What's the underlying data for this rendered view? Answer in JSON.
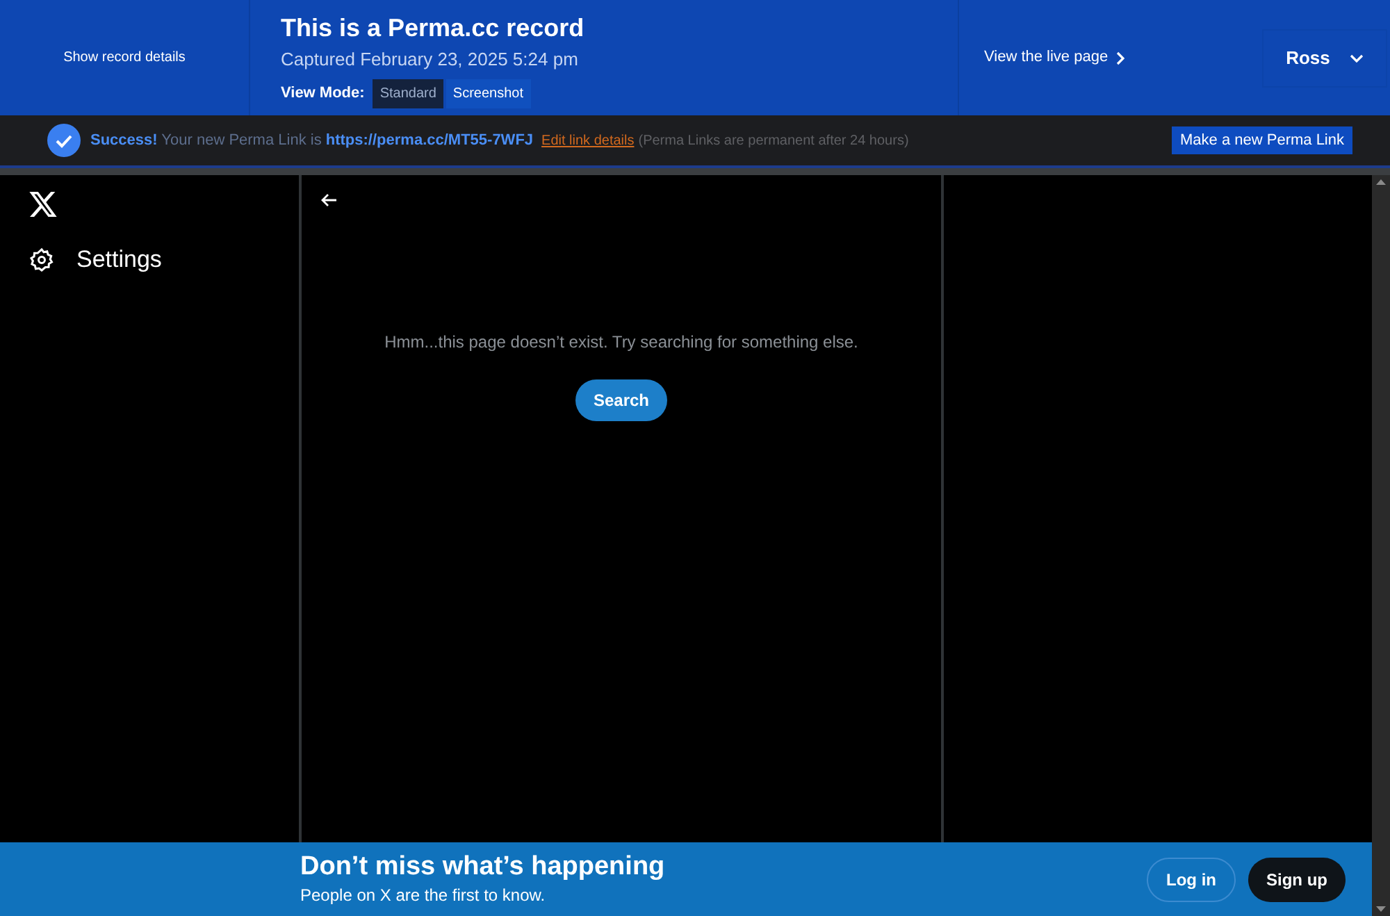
{
  "header": {
    "details_link": "Show record details",
    "title": "This is a Perma.cc record",
    "captured": "Captured February 23, 2025 5:24 pm",
    "view_mode_label": "View Mode:",
    "view_modes": [
      {
        "label": "Standard",
        "selected": true
      },
      {
        "label": "Screenshot",
        "selected": false
      }
    ],
    "live_link": "View the live page",
    "user": "Ross"
  },
  "notice": {
    "success": "Success!",
    "text": "Your new Perma Link is",
    "url": "https://perma.cc/MT55-7WFJ",
    "edit_link": "Edit link details",
    "note": "(Perma Links are permanent after 24 hours)",
    "button": "Make a new Perma Link"
  },
  "sidebar": {
    "items": [
      {
        "label": "Settings"
      }
    ]
  },
  "main": {
    "message": "Hmm...this page doesn’t exist. Try searching for something else.",
    "button": "Search"
  },
  "banner": {
    "title": "Don’t miss what’s happening",
    "subtitle": "People on X are the first to know.",
    "login": "Log in",
    "signup": "Sign up"
  }
}
